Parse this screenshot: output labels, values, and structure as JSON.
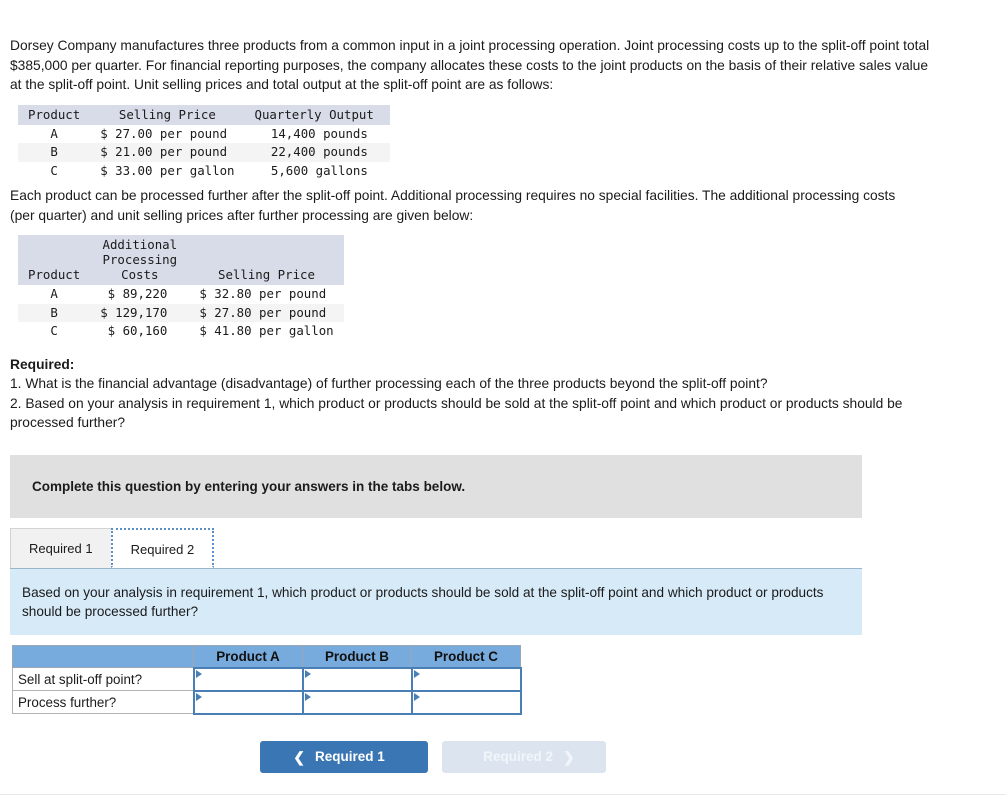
{
  "intro": {
    "paragraph1": "Dorsey Company manufactures three products from a common input in a joint processing operation. Joint processing costs up to the split-off point total $385,000 per quarter. For financial reporting purposes, the company allocates these costs to the joint products on the basis of their relative sales value at the split-off point. Unit selling prices and total output at the split-off point are as follows:",
    "paragraph2": "Each product can be processed further after the split-off point. Additional processing requires no special facilities. The additional processing costs (per quarter) and unit selling prices after further processing are given below:"
  },
  "table1": {
    "headers": [
      "Product",
      "Selling Price",
      "Quarterly Output"
    ],
    "rows": [
      {
        "product": "A",
        "selling_price": "$ 27.00 per pound",
        "quarterly_output": "14,400 pounds"
      },
      {
        "product": "B",
        "selling_price": "$ 21.00 per pound",
        "quarterly_output": "22,400 pounds"
      },
      {
        "product": "C",
        "selling_price": "$ 33.00 per gallon",
        "quarterly_output": "5,600 gallons"
      }
    ]
  },
  "table2": {
    "headers": {
      "product": "Product",
      "additional_costs_line1": "Additional",
      "additional_costs_line2": "Processing",
      "additional_costs_line3": "Costs",
      "selling_price": "Selling Price"
    },
    "rows": [
      {
        "product": "A",
        "additional_cost": "$ 89,220",
        "selling_price": "$ 32.80 per pound"
      },
      {
        "product": "B",
        "additional_cost": "$ 129,170",
        "selling_price": "$ 27.80 per pound"
      },
      {
        "product": "C",
        "additional_cost": "$ 60,160",
        "selling_price": "$ 41.80 per gallon"
      }
    ]
  },
  "required": {
    "title": "Required:",
    "item1": "1. What is the financial advantage (disadvantage) of further processing each of the three products beyond the split-off point?",
    "item2": "2. Based on your analysis in requirement 1, which product or products should be sold at the split-off point and which product or products should be processed further?"
  },
  "instruction_banner": {
    "text": "Complete this question by entering your answers in the tabs below."
  },
  "tabs": [
    {
      "label": "Required 1",
      "active": false
    },
    {
      "label": "Required 2",
      "active": true
    }
  ],
  "question_panel": {
    "text": "Based on your analysis in requirement 1, which product or products should be sold at the split-off point and which product or products should be processed further?"
  },
  "answer_grid": {
    "corner_header": "",
    "column_headers": [
      "Product A",
      "Product B",
      "Product C"
    ],
    "rows": [
      {
        "label": "Sell at split-off point?",
        "values": [
          "",
          "",
          ""
        ]
      },
      {
        "label": "Process further?",
        "values": [
          "",
          "",
          ""
        ]
      }
    ]
  },
  "nav": {
    "prev_label": "Required 1",
    "prev_icon": "chevron-left-icon",
    "next_label": "Required 2",
    "next_icon": "chevron-right-icon"
  },
  "colors": {
    "primary_button": "#3b76b4",
    "disabled_button": "#dce5ef",
    "grid_header_blue": "#78abdd",
    "panel_blue": "#d6eaf8",
    "banner_grey": "#e0e0e0",
    "table_header_grey": "#d8dce8",
    "tab_active_border": "#5b8fc9"
  }
}
